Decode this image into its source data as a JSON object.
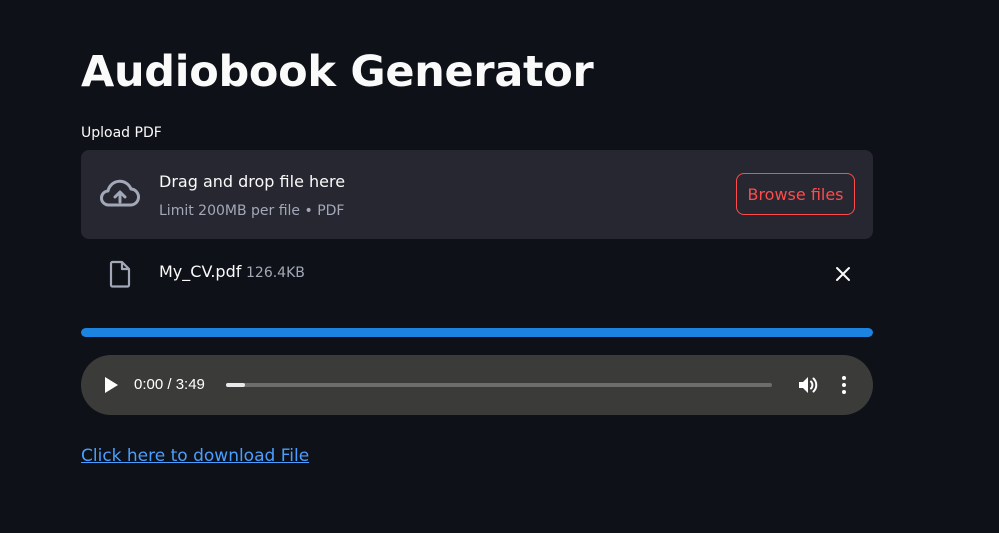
{
  "header": {
    "title": "Audiobook Generator"
  },
  "uploader": {
    "label": "Upload PDF",
    "drop_text": "Drag and drop file here",
    "limit_text": "Limit 200MB per file • PDF",
    "browse_label": "Browse files",
    "icon": "cloud-upload-icon"
  },
  "uploaded_file": {
    "name": "My_CV.pdf",
    "size": "126.4KB",
    "icon": "file-icon",
    "remove_icon": "close-icon"
  },
  "progress": {
    "percent": 100,
    "color": "#1c83e1"
  },
  "audio": {
    "time": "0:00 / 3:49",
    "played_fraction": 0.035,
    "play_icon": "play-icon",
    "volume_icon": "volume-icon",
    "menu_icon": "more-vertical-icon"
  },
  "download": {
    "link_text": "Click here to download File"
  },
  "colors": {
    "background": "#0e1117",
    "panel": "#262730",
    "accent": "#ff4b4b",
    "link": "#4a9eff",
    "player": "#3b3c3a"
  }
}
